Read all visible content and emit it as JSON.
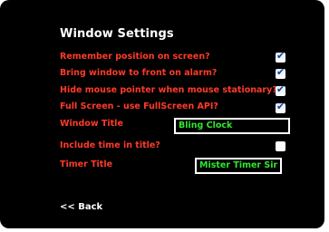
{
  "window_settings": {
    "title": "Window Settings",
    "rows": [
      {
        "label": "Remember position on screen?",
        "checked": true
      },
      {
        "label": "Bring window to front on alarm?",
        "checked": true
      },
      {
        "label": "Hide mouse pointer when mouse stationary?",
        "checked": true
      },
      {
        "label": "Full Screen - use FullScreen API?",
        "checked": true
      }
    ],
    "window_title": {
      "label": "Window Title",
      "value": "Bling Clock"
    },
    "include_time": {
      "label": "Include time in title?",
      "checked": false
    },
    "timer_title": {
      "label": "Timer Title",
      "value": "Mister Timer Sir"
    },
    "back_label": "<< Back"
  },
  "colors": {
    "background": "#000000",
    "label_red": "#ff3a2a",
    "value_green": "#2ee62e",
    "heading_white": "#ffffff"
  }
}
